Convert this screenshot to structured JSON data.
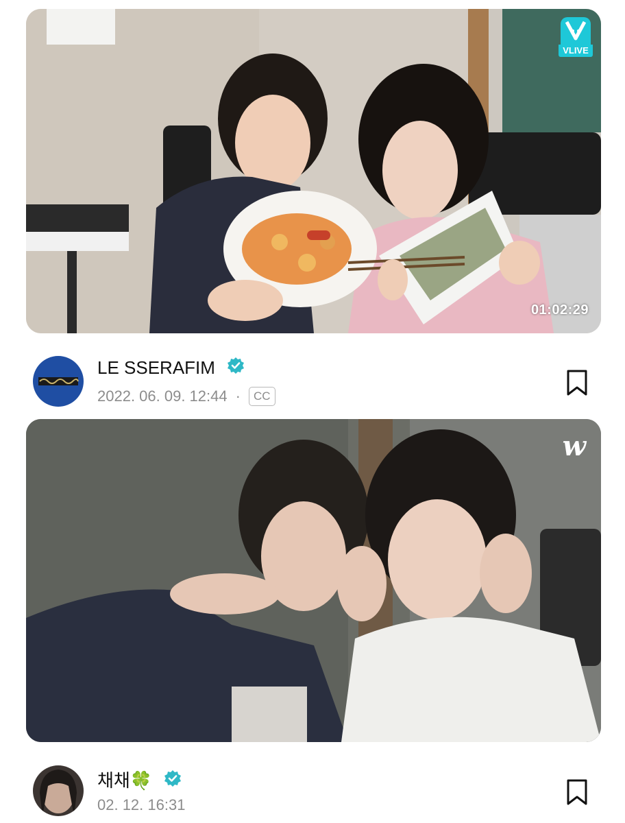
{
  "posts": [
    {
      "badge": "VLIVE",
      "duration": "01:02:29",
      "channel": "LE SSERAFIM",
      "timestamp": "2022. 06. 09. 12:44",
      "separator": "·",
      "cc_label": "CC"
    },
    {
      "badge_mark": "w",
      "channel": "채채🍀",
      "timestamp": "02. 12. 16:31"
    }
  ],
  "icons": {
    "verified": "verified-check-icon",
    "bookmark": "bookmark-icon",
    "vlive": "vlive-logo-icon",
    "weverse": "weverse-logo-icon"
  },
  "colors": {
    "verified": "#2fb8c6",
    "vlive": "#1ec8d8",
    "meta_gray": "#8c8c8c"
  }
}
